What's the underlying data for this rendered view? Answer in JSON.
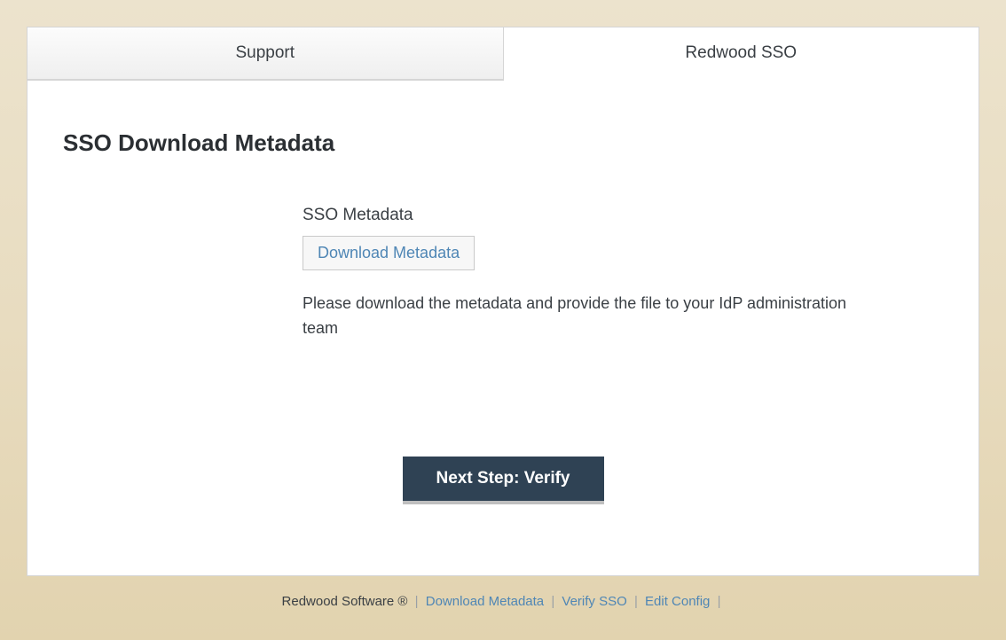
{
  "tabs": {
    "support": "Support",
    "redwood_sso": "Redwood SSO"
  },
  "page": {
    "title": "SSO Download Metadata"
  },
  "section": {
    "label": "SSO Metadata",
    "download_button": "Download Metadata",
    "description": "Please download the metadata and provide the file to your IdP administration team"
  },
  "actions": {
    "next_step": "Next Step: Verify"
  },
  "footer": {
    "brand": "Redwood Software ®",
    "links": {
      "download_metadata": "Download Metadata",
      "verify_sso": "Verify SSO",
      "edit_config": "Edit Config"
    }
  }
}
